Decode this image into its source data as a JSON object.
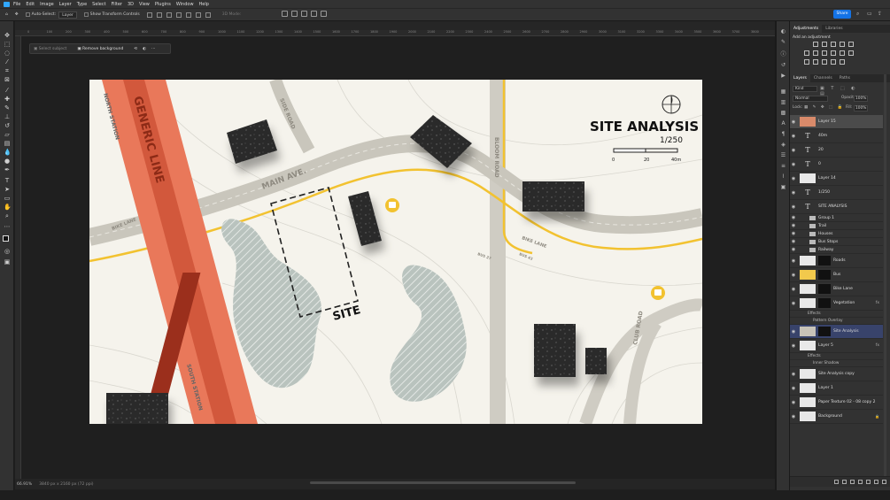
{
  "menu": [
    "File",
    "Edit",
    "Image",
    "Layer",
    "Type",
    "Select",
    "Filter",
    "3D",
    "View",
    "Plugins",
    "Window",
    "Help"
  ],
  "options": {
    "auto_select_label": "Auto-Select:",
    "auto_select_value": "Layer",
    "transform_label": "Show Transform Controls",
    "mode_3d": "3D Mode:",
    "share_label": "Share"
  },
  "contextbar": {
    "select_subject": "Select subject",
    "remove_background": "Remove background"
  },
  "ruler_ticks": [
    "0",
    "100",
    "200",
    "300",
    "400",
    "500",
    "600",
    "700",
    "800",
    "900",
    "1000",
    "1100",
    "1200",
    "1300",
    "1400",
    "1500",
    "1600",
    "1700",
    "1800",
    "1900",
    "2000",
    "2100",
    "2200",
    "2300",
    "2400",
    "2500",
    "2600",
    "2700",
    "2800",
    "2900",
    "3000",
    "3100",
    "3200",
    "3300",
    "3400",
    "3500",
    "3600",
    "3700",
    "3800"
  ],
  "status": {
    "zoom": "66.91%",
    "doc_size": "3840 px x 2160 px (72 ppi)"
  },
  "map": {
    "title": "SITE ANALYSIS",
    "scale": "1/250",
    "scale_ticks": [
      "0",
      "20",
      "40m"
    ],
    "labels": {
      "generic_line": "GENERIC LINE",
      "north_station": "NORTH STATION",
      "south_station": "SOUTH STATION",
      "main_ave": "MAIN AVE.",
      "side_road": "SIDE ROAD",
      "bloom_road": "BLOOM ROAD",
      "club_road": "CLUB ROAD",
      "bike_lane_left": "BIKE LANE",
      "bike_lane_right": "BIKE LANE",
      "bus_43": "BUS 43",
      "bus_27": "BUS 27",
      "site": "SITE"
    }
  },
  "panels": {
    "adjust_tabs": [
      "Adjustments",
      "Libraries"
    ],
    "add_adjustment": "Add an adjustment",
    "layer_tabs": [
      "Layers",
      "Channels",
      "Paths"
    ],
    "filter_kind": "Kind",
    "blend_mode": "Normal",
    "opacity_label": "Opacity:",
    "opacity_value": "100%",
    "lock_label": "Lock:",
    "fill_label": "Fill:",
    "fill_value": "100%"
  },
  "layers": [
    {
      "name": "Layer 15",
      "kind": "image",
      "sel": true
    },
    {
      "name": "40m",
      "kind": "text"
    },
    {
      "name": "20",
      "kind": "text"
    },
    {
      "name": "0",
      "kind": "text"
    },
    {
      "name": "Layer 14",
      "kind": "image"
    },
    {
      "name": "1/250",
      "kind": "text"
    },
    {
      "name": "SITE ANALYSIS",
      "kind": "text"
    }
  ],
  "groups": [
    "Group 1",
    "Trail",
    "Houses",
    "Bus Stops",
    "Railway"
  ],
  "layers2": [
    {
      "name": "Roads",
      "kind": "mask"
    },
    {
      "name": "Bus",
      "kind": "mask",
      "color": "#f2c94c"
    },
    {
      "name": "Bike Lane",
      "kind": "mask"
    },
    {
      "name": "Vegetation",
      "kind": "mask",
      "fx": true
    }
  ],
  "veg_effects": [
    "Effects",
    "Pattern Overlay"
  ],
  "layers3": [
    {
      "name": "Site Analysis",
      "kind": "mask",
      "blue": true
    },
    {
      "name": "Layer 5",
      "kind": "image",
      "fx": true
    }
  ],
  "layer5_effects": [
    "Effects",
    "Inner Shadow"
  ],
  "layers4": [
    {
      "name": "Site Analysis copy",
      "kind": "image"
    },
    {
      "name": "Layer 1",
      "kind": "image"
    },
    {
      "name": "Paper Texture 02 - 08 copy 2",
      "kind": "image"
    },
    {
      "name": "Background",
      "kind": "image",
      "lock": true
    }
  ]
}
